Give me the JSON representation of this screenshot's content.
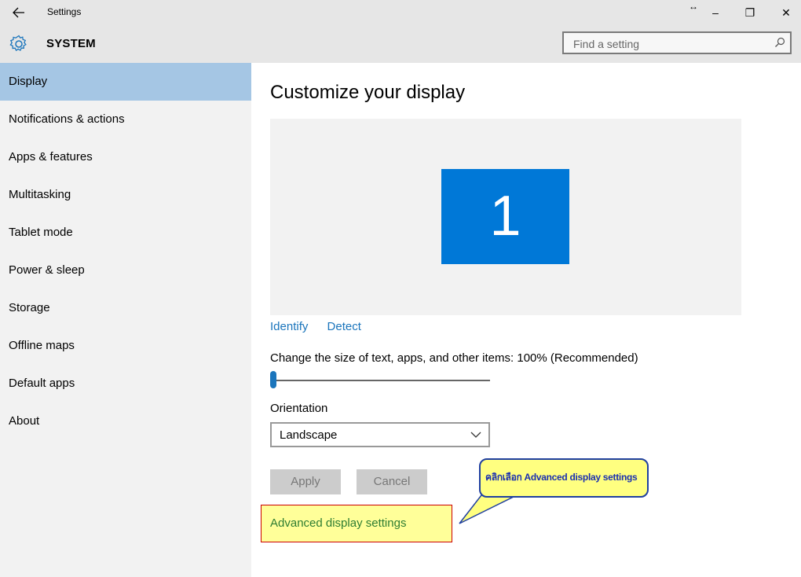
{
  "window": {
    "title": "Settings",
    "back_icon": "back-arrow-icon",
    "resize_icon": "resize-arrows-icon",
    "minimize": "–",
    "maximize": "❐",
    "close": "✕"
  },
  "header": {
    "section": "SYSTEM",
    "icon": "gear-icon",
    "search_placeholder": "Find a setting",
    "search_icon": "search-icon"
  },
  "sidebar": {
    "items": [
      {
        "label": "Display",
        "active": true
      },
      {
        "label": "Notifications & actions",
        "active": false
      },
      {
        "label": "Apps & features",
        "active": false
      },
      {
        "label": "Multitasking",
        "active": false
      },
      {
        "label": "Tablet mode",
        "active": false
      },
      {
        "label": "Power & sleep",
        "active": false
      },
      {
        "label": "Storage",
        "active": false
      },
      {
        "label": "Offline maps",
        "active": false
      },
      {
        "label": "Default apps",
        "active": false
      },
      {
        "label": "About",
        "active": false
      }
    ]
  },
  "main": {
    "heading": "Customize your display",
    "monitor_number": "1",
    "identify": "Identify",
    "detect": "Detect",
    "scale_label": "Change the size of text, apps, and other items: 100% (Recommended)",
    "orientation_label": "Orientation",
    "orientation_value": "Landscape",
    "apply": "Apply",
    "cancel": "Cancel",
    "advanced": "Advanced display settings"
  },
  "annotation": {
    "text": "คลิกเลือก Advanced display settings"
  },
  "colors": {
    "accent": "#0078d7",
    "link": "#1b75bc",
    "nav_active": "#a5c6e4",
    "highlight": "#ffff99",
    "callout_border": "#1f3fa0"
  }
}
